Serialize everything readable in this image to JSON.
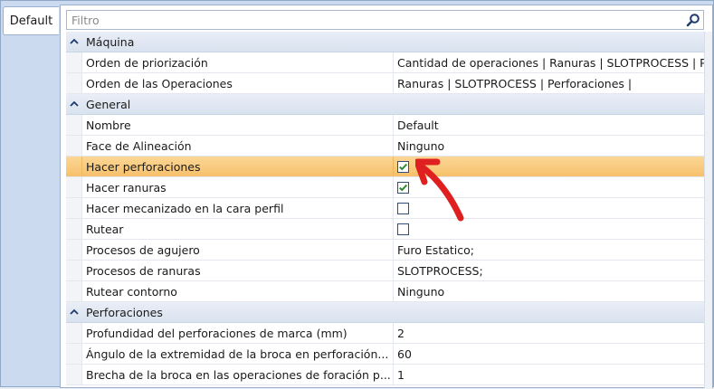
{
  "tab": {
    "label": "Default"
  },
  "filter": {
    "placeholder": "Filtro"
  },
  "categories": [
    {
      "label": "Máquina",
      "rows": [
        {
          "name": "Orden de priorización",
          "value": "Cantidad de operaciones | Ranuras | SLOTPROCESS | P"
        },
        {
          "name": "Orden de las Operaciones",
          "value": "Ranuras | SLOTPROCESS | Perforaciones |"
        }
      ]
    },
    {
      "label": "General",
      "rows": [
        {
          "name": "Nombre",
          "value": "Default"
        },
        {
          "name": "Face de Alineación",
          "value": "Ninguno"
        },
        {
          "name": "Hacer perforaciones",
          "checked": true,
          "selected": true
        },
        {
          "name": "Hacer ranuras",
          "checked": true
        },
        {
          "name": "Hacer mecanizado en la cara perfil",
          "checked": false
        },
        {
          "name": "Rutear",
          "checked": false
        },
        {
          "name": "Procesos de agujero",
          "value": "Furo Estatico;"
        },
        {
          "name": "Procesos de ranuras",
          "value": "SLOTPROCESS;"
        },
        {
          "name": "Rutear contorno",
          "value": "Ninguno"
        }
      ]
    },
    {
      "label": "Perforaciones",
      "rows": [
        {
          "name": "Profundidad del perforaciones de marca (mm)",
          "value": "2"
        },
        {
          "name": "Ángulo de la extremidad de la broca en perforación...",
          "value": "60"
        },
        {
          "name": "Brecha de la broca en las operaciones de foración p...",
          "value": "1"
        }
      ]
    }
  ],
  "colors": {
    "selected": "#f6c06b",
    "check": "#2e8b2e",
    "arrow": "#e02020",
    "border": "#9ab0cc"
  },
  "icons": {
    "search": "search-icon",
    "collapse": "chevron-up-icon",
    "annotation": "red-arrow"
  }
}
